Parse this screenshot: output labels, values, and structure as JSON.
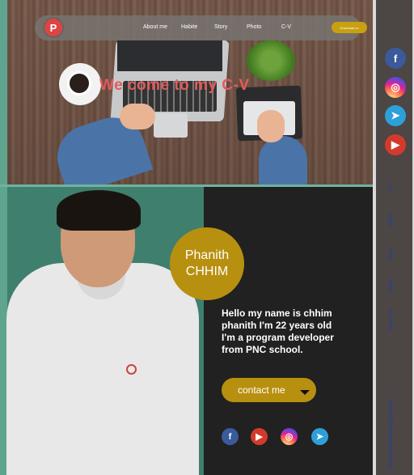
{
  "navbar": {
    "logo": "P",
    "items": [
      {
        "label": "About me"
      },
      {
        "label": "Habite"
      },
      {
        "label": "Story"
      },
      {
        "label": "Photo"
      },
      {
        "label": "C-V"
      }
    ],
    "download_label": "Download cv"
  },
  "hero": {
    "title": "We come to my C-V"
  },
  "profile": {
    "first_name": "Phanith",
    "last_name": "CHHIM",
    "intro": "Hello my name is chhim phanith I'm 22 years old I'm a program developer from PNC school.",
    "contact_label": "contact me"
  },
  "bottom_icons": [
    {
      "icon": "facebook-icon",
      "glyph": "f",
      "color": "#3a5a9b"
    },
    {
      "icon": "youtube-icon",
      "glyph": "▶",
      "color": "#d43a2b"
    },
    {
      "icon": "instagram-icon",
      "glyph": "◎",
      "color": "#d6249f"
    },
    {
      "icon": "telegram-icon",
      "glyph": "➤",
      "color": "#2ea0d8"
    }
  ],
  "sidebar": {
    "icons": [
      {
        "icon": "facebook-icon",
        "glyph": "f"
      },
      {
        "icon": "instagram-icon",
        "glyph": "◎"
      },
      {
        "icon": "telegram-icon",
        "glyph": "➤"
      },
      {
        "icon": "youtube-icon",
        "glyph": "▶"
      }
    ],
    "links": [
      {
        "label": "C-V"
      },
      {
        "label": "Photo"
      },
      {
        "label": "Story"
      },
      {
        "label": "Habite"
      },
      {
        "label": "About me"
      },
      {
        "label": "Email: phanithchhim@gmail.com"
      }
    ]
  }
}
